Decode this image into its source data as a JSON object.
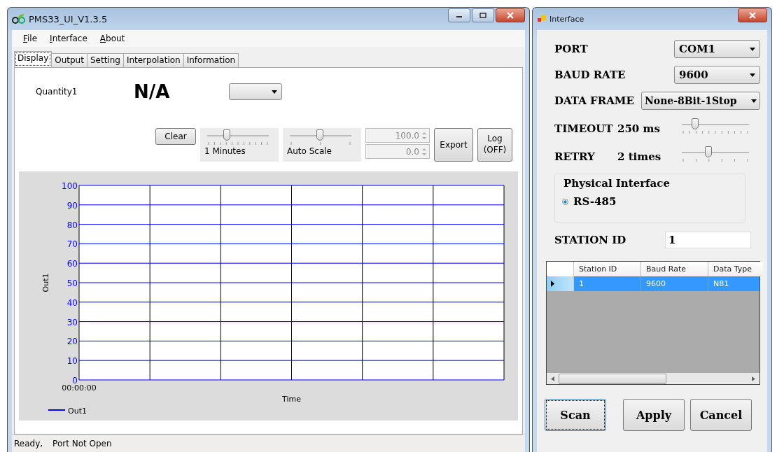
{
  "main_window": {
    "title": "PMS33_UI_V1.3.5",
    "menu": [
      "File",
      "Interface",
      "About"
    ],
    "tabs": [
      {
        "label": "Display",
        "selected": true
      },
      {
        "label": "Output",
        "selected": false
      },
      {
        "label": "Setting",
        "selected": false
      },
      {
        "label": "Interpolation",
        "selected": false
      },
      {
        "label": "Information",
        "selected": false
      }
    ],
    "display": {
      "quantity_label": "Quantity1",
      "reading": "N/A",
      "clear_button": "Clear",
      "time_slider": {
        "level": 0.32,
        "label": "1 Minutes"
      },
      "scale_slider": {
        "level": 0.5,
        "label": "Auto Scale"
      },
      "upper_limit": "100.0",
      "lower_limit": "0.0",
      "export_button": "Export",
      "log_button": "Log (OFF)",
      "chart_data": {
        "type": "line",
        "annotations": [
          {
            "text": "Time"
          }
        ],
        "ylabel": "Out1",
        "ylim": [
          0,
          100
        ],
        "yticks": [
          0,
          10,
          20,
          30,
          40,
          50,
          60,
          70,
          80,
          90,
          100
        ],
        "categories": [
          "00:00:00"
        ],
        "grid": true,
        "series": [
          {
            "name": "Out1",
            "color": "#0000ff",
            "values": [
              null
            ]
          }
        ]
      }
    },
    "status_bar": [
      "Ready,",
      "Port Not Open"
    ]
  },
  "interface_window": {
    "title": "Interface",
    "port": {
      "label": "PORT",
      "value": "COM1"
    },
    "baud_rate": {
      "label": "BAUD RATE",
      "value": "9600"
    },
    "data_frame": {
      "label": "DATA FRAME",
      "value": "None-8Bit-1Stop"
    },
    "timeout": {
      "label": "TIMEOUT",
      "reading": "250 ms",
      "level": 0.2
    },
    "retry": {
      "label": "RETRY",
      "reading": "2 times",
      "level": 0.4
    },
    "physical_interface": {
      "title": "Physical Interface",
      "options": [
        {
          "label": "RS-485",
          "selected": true
        }
      ]
    },
    "station_id": {
      "label": "STATION ID",
      "value": "1"
    },
    "table": {
      "columns": [
        "Station ID",
        "Baud Rate",
        "Data Type"
      ],
      "rows": [
        {
          "cells": [
            "1",
            "9600",
            "N81"
          ],
          "selected": true
        }
      ]
    },
    "buttons": [
      {
        "label": "Scan",
        "focused": true
      },
      {
        "label": "Apply",
        "focused": false
      },
      {
        "label": "Cancel",
        "focused": false
      }
    ]
  }
}
